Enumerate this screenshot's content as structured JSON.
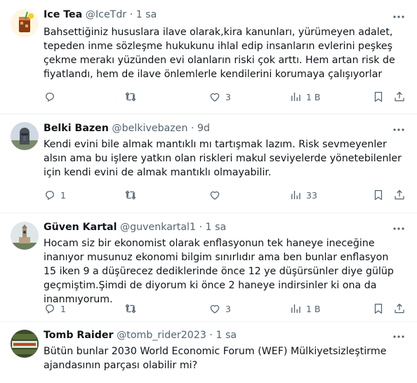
{
  "tweets": [
    {
      "name": "Ice Tea",
      "handle": "@IceTdr",
      "time": "1 sa",
      "text": "Bahsettiğiniz hususlara ilave olarak,kira kanunları, yürümeyen adalet, tepeden inme sözleşme hukukunu ihlal edip insanların evlerini peşkeş çekme merakı yüzünden evi olanların riski çok arttı. Hem artan risk de fiyatlandı, hem de ilave önlemlerle kendilerini korumaya çalışıyorlar",
      "replies": "",
      "retweets": "",
      "likes": "3",
      "views": "1 B"
    },
    {
      "name": "Belki Bazen",
      "handle": "@belkivebazen",
      "time": "9d",
      "text": "Kendi evini bile almak mantıklı mı tartışmak lazım. Risk sevmeyenler alsın ama bu işlere yatkın olan riskleri makul seviyelerde yönetebilenler için kendi evini de almak mantıklı olmayabilir.",
      "replies": "1",
      "retweets": "",
      "likes": "",
      "views": "33"
    },
    {
      "name": "Güven Kartal",
      "handle": "@guvenkartal1",
      "time": "1 sa",
      "text": "Hocam siz bir ekonomist olarak enflasyonun tek haneye ineceğine inanıyor musunuz ekonomi bilgim sınırlıdır ama ben bunlar enflasyon 15 iken 9 a düşürecez dediklerinde önce 12 ye düşürsünler diye gülüp geçmiştim.Şimdi de diyorum ki önce 2 haneye indirsinler ki ona da inanmıyorum.",
      "replies": "1",
      "retweets": "",
      "likes": "3",
      "views": "1 B"
    },
    {
      "name": "Tomb Raider",
      "handle": "@tomb_rider2023",
      "time": "1 sa",
      "text": "Bütün bunlar 2030 World Economic Forum (WEF) Mülkiyetsizleştirme ajandasının parçası olabilir mi?",
      "replies": "",
      "retweets": "",
      "likes": "",
      "views": ""
    }
  ],
  "separator": "·",
  "colors": {
    "text": "#0f1419",
    "muted": "#536471",
    "divider": "#eff3f4"
  },
  "icons": [
    "reply-icon",
    "retweet-icon",
    "like-icon",
    "views-icon",
    "bookmark-icon",
    "share-icon",
    "more-icon"
  ]
}
